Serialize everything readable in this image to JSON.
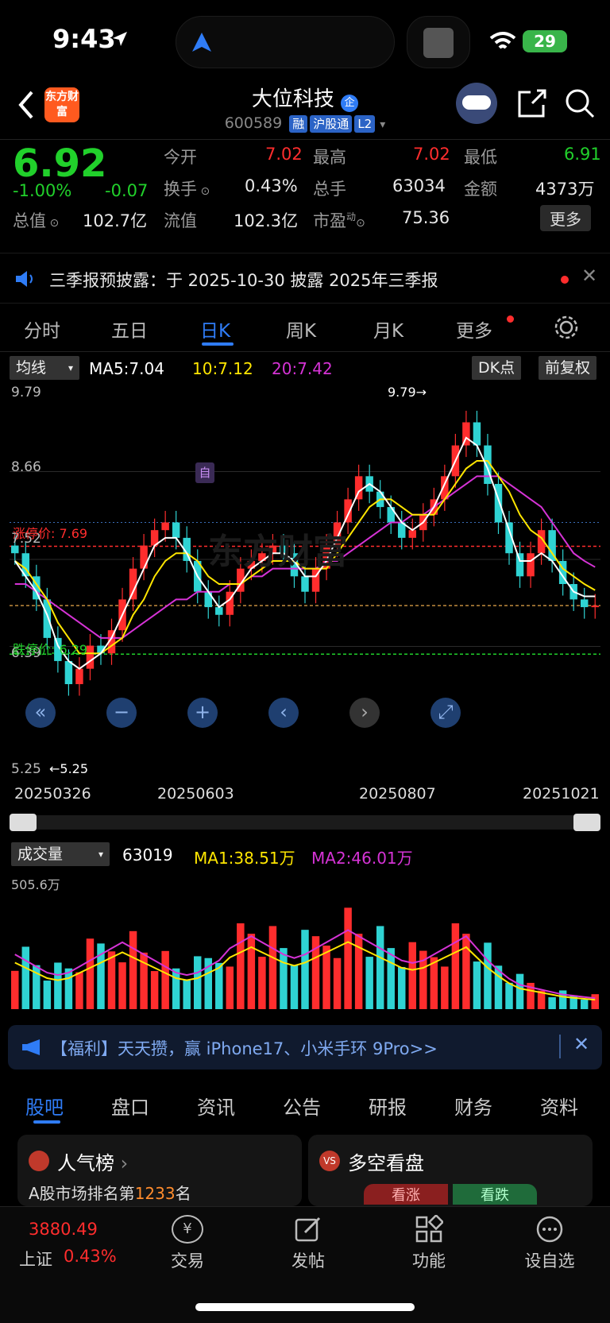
{
  "status": {
    "time": "9:43",
    "battery": "29"
  },
  "header": {
    "title": "大位科技",
    "title_badge": "企",
    "code": "600589",
    "tags": [
      "融",
      "沪股通",
      "L2"
    ],
    "logo": "东方财富"
  },
  "quote": {
    "price": "6.92",
    "pct": "-1.00%",
    "chg": "-0.07",
    "open_label": "今开",
    "open": "7.02",
    "high_label": "最高",
    "high": "7.02",
    "low_label": "最低",
    "low": "6.91",
    "turnover_label": "换手",
    "turnover": "0.43%",
    "vol_label": "总手",
    "vol": "63034",
    "amount_label": "金额",
    "amount": "4373万",
    "mcap_label": "总值",
    "mcap": "102.7亿",
    "float_label": "流值",
    "float": "102.3亿",
    "pe_label": "市盈",
    "pe_sup": "动",
    "pe": "75.36",
    "more": "更多"
  },
  "notice": {
    "text": "三季报预披露：于 2025-10-30 披露 2025年三季报"
  },
  "chart_tabs": [
    "分时",
    "五日",
    "日K",
    "周K",
    "月K",
    "更多"
  ],
  "kbar": {
    "indicator": "均线",
    "ma5": "MA5:7.04",
    "ma10": "10:7.12",
    "ma20": "20:7.42",
    "dk": "DK点",
    "adj": "前复权"
  },
  "kchart": {
    "y_labels": [
      "9.79",
      "8.66",
      "7.52",
      "6.39",
      "5.25"
    ],
    "max_label": "9.79",
    "min_label": "5.25",
    "up_limit": "涨停价: 7.69",
    "down_limit": "跌停价: 6.29",
    "self_marker": "自",
    "watermark": "东方财富",
    "dates": [
      "20250326",
      "20250603",
      "20250807",
      "20251021"
    ]
  },
  "volbar": {
    "indicator": "成交量",
    "vol": "63019",
    "ma1": "MA1:38.51万",
    "ma2": "MA2:46.01万",
    "max": "505.6万"
  },
  "ad": {
    "text": "【福利】天天攒，赢 iPhone17、小米手环 9Pro>>"
  },
  "content_tabs": [
    "股吧",
    "盘口",
    "资讯",
    "公告",
    "研报",
    "财务",
    "资料"
  ],
  "cards": {
    "popular": "人气榜",
    "popular_sub_pre": "A股市场排名第",
    "popular_rank": "1233",
    "popular_sub_post": "名",
    "bull": "多空看盘",
    "bull_up": "看涨",
    "bull_down": "看跌"
  },
  "bottom": {
    "index_value": "3880.49",
    "index_name": "上证",
    "index_pct": "0.43%",
    "items": [
      "交易",
      "发帖",
      "功能",
      "设自选"
    ]
  },
  "colors": {
    "up": "#ff2d2d",
    "down": "#21d02b",
    "accent": "#2f7cf6",
    "ma5": "#ffffff",
    "ma10": "#ffe600",
    "ma20": "#d633d6",
    "bar_down": "#2fd3d3"
  },
  "chart_data": {
    "type": "candlestick",
    "ylim": [
      5.25,
      9.79
    ],
    "close": [
      7.6,
      7.3,
      7.0,
      6.5,
      6.2,
      5.9,
      6.1,
      6.4,
      6.3,
      6.6,
      7.0,
      7.4,
      7.7,
      7.9,
      8.0,
      7.8,
      7.5,
      7.1,
      6.9,
      6.8,
      7.1,
      7.4,
      7.5,
      7.6,
      7.7,
      7.6,
      7.3,
      7.1,
      7.4,
      7.7,
      8.0,
      8.3,
      8.6,
      8.4,
      8.2,
      8.0,
      7.8,
      7.9,
      8.1,
      8.3,
      8.6,
      9.0,
      9.3,
      9.0,
      8.5,
      8.0,
      7.6,
      7.3,
      7.6,
      7.9,
      7.5,
      7.2,
      7.0,
      6.9,
      6.92
    ],
    "ma5": [
      7.5,
      7.3,
      7.1,
      6.8,
      6.4,
      6.2,
      6.1,
      6.2,
      6.3,
      6.5,
      6.8,
      7.1,
      7.4,
      7.7,
      7.8,
      7.8,
      7.6,
      7.3,
      7.1,
      6.9,
      7.0,
      7.2,
      7.4,
      7.5,
      7.6,
      7.6,
      7.5,
      7.3,
      7.3,
      7.5,
      7.8,
      8.1,
      8.4,
      8.5,
      8.4,
      8.2,
      8.0,
      7.9,
      8.0,
      8.2,
      8.5,
      8.8,
      9.1,
      9.0,
      8.7,
      8.3,
      7.9,
      7.5,
      7.5,
      7.6,
      7.5,
      7.3,
      7.1,
      7.04,
      7.04
    ],
    "ma10": [
      7.5,
      7.4,
      7.2,
      7.0,
      6.7,
      6.5,
      6.3,
      6.3,
      6.3,
      6.4,
      6.5,
      6.8,
      7.0,
      7.3,
      7.5,
      7.6,
      7.6,
      7.5,
      7.3,
      7.2,
      7.2,
      7.2,
      7.3,
      7.4,
      7.5,
      7.5,
      7.5,
      7.4,
      7.4,
      7.4,
      7.6,
      7.8,
      8.0,
      8.2,
      8.3,
      8.3,
      8.2,
      8.1,
      8.1,
      8.1,
      8.3,
      8.5,
      8.7,
      8.8,
      8.8,
      8.6,
      8.4,
      8.1,
      7.9,
      7.8,
      7.6,
      7.4,
      7.3,
      7.2,
      7.12
    ],
    "ma20": [
      7.2,
      7.2,
      7.1,
      7.0,
      6.9,
      6.8,
      6.7,
      6.6,
      6.5,
      6.5,
      6.5,
      6.6,
      6.7,
      6.8,
      6.9,
      7.0,
      7.0,
      7.1,
      7.1,
      7.1,
      7.2,
      7.2,
      7.3,
      7.3,
      7.4,
      7.4,
      7.4,
      7.4,
      7.4,
      7.5,
      7.5,
      7.6,
      7.7,
      7.8,
      7.9,
      8.0,
      8.0,
      8.1,
      8.1,
      8.2,
      8.3,
      8.4,
      8.5,
      8.6,
      8.6,
      8.6,
      8.5,
      8.4,
      8.3,
      8.2,
      8.0,
      7.8,
      7.6,
      7.5,
      7.42
    ],
    "volume_ma": [
      0.45,
      0.4,
      0.35,
      0.3,
      0.28,
      0.3,
      0.35,
      0.4,
      0.45,
      0.5,
      0.55,
      0.5,
      0.45,
      0.4,
      0.35,
      0.3,
      0.28,
      0.3,
      0.35,
      0.4,
      0.5,
      0.55,
      0.6,
      0.55,
      0.5,
      0.45,
      0.42,
      0.45,
      0.5,
      0.55,
      0.6,
      0.65,
      0.6,
      0.55,
      0.5,
      0.45,
      0.4,
      0.38,
      0.4,
      0.45,
      0.5,
      0.55,
      0.6,
      0.5,
      0.4,
      0.32,
      0.25,
      0.2,
      0.18,
      0.16,
      0.14,
      0.12,
      0.11,
      0.1,
      0.09
    ]
  }
}
